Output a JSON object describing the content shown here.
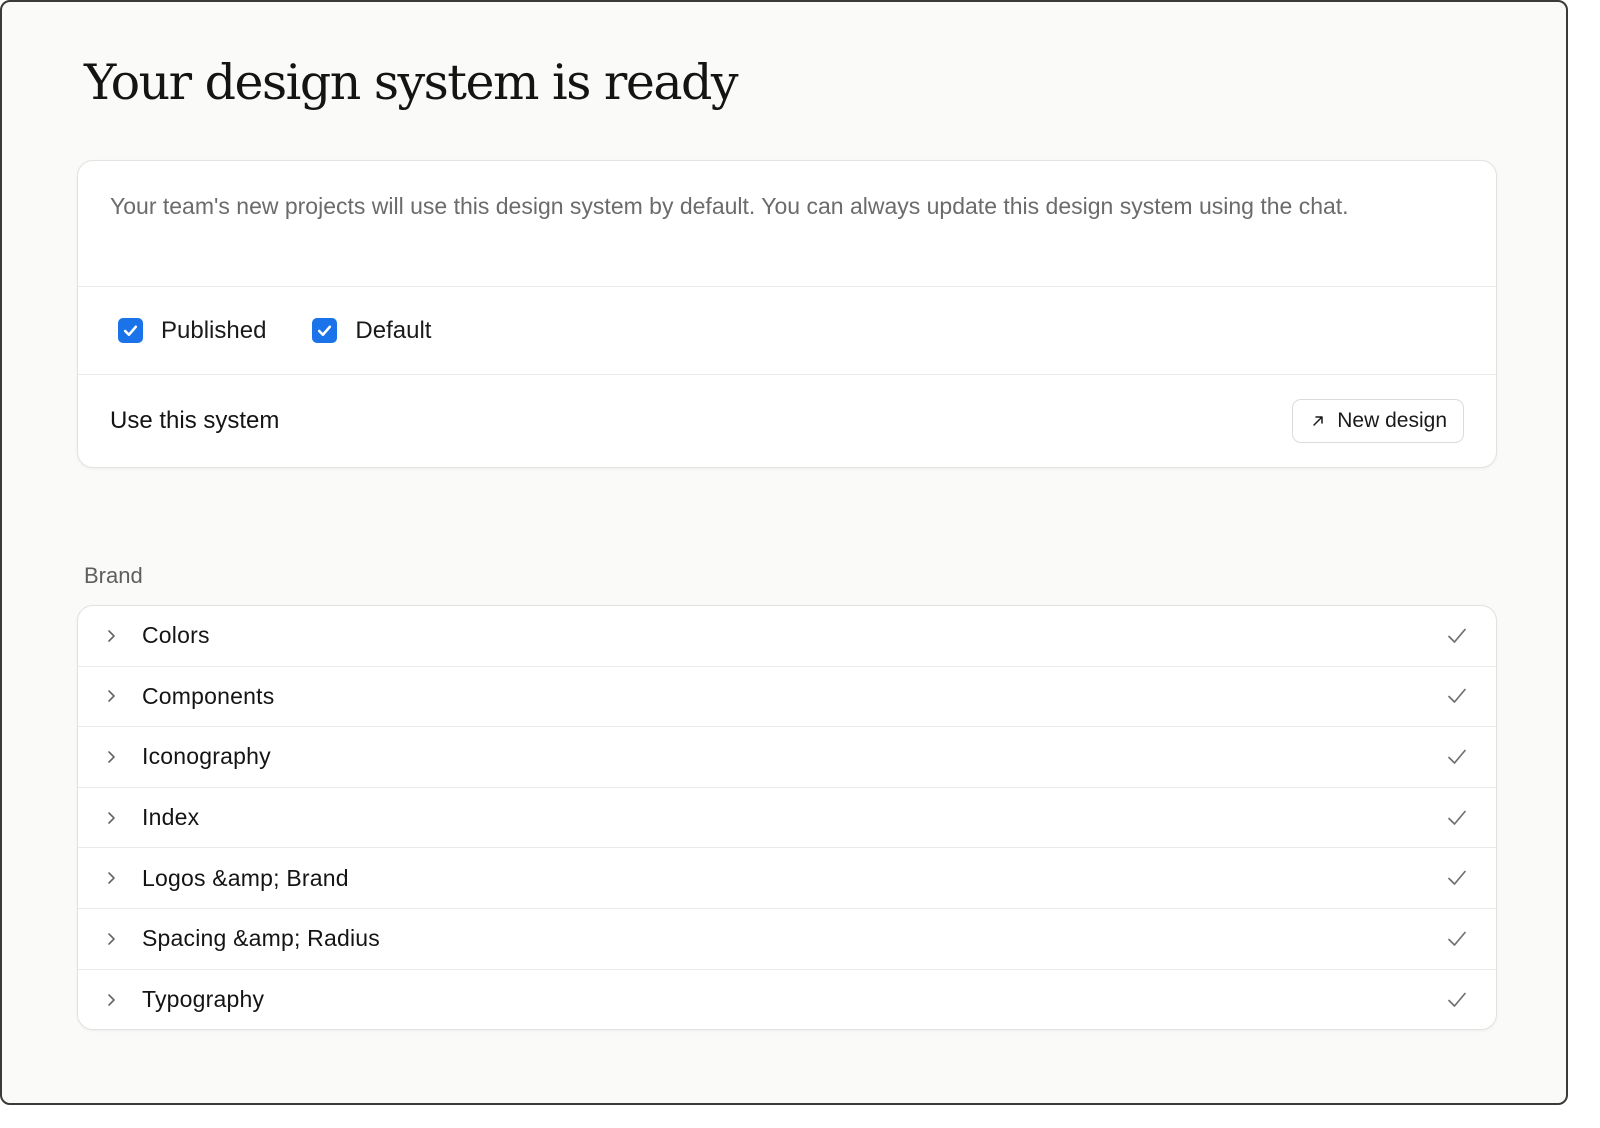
{
  "page": {
    "title": "Your design system is ready"
  },
  "info": {
    "description": "Your team's new projects will use this design system by default. You can always update this design system using the chat.",
    "checkboxes": [
      {
        "label": "Published",
        "checked": true
      },
      {
        "label": "Default",
        "checked": true
      }
    ],
    "use_label": "Use this system",
    "new_design_label": "New design",
    "new_design_icon": "arrow-up-right-icon"
  },
  "brand": {
    "section_label": "Brand",
    "items": [
      {
        "label": "Colors",
        "complete": true
      },
      {
        "label": "Components",
        "complete": true
      },
      {
        "label": "Iconography",
        "complete": true
      },
      {
        "label": "Index",
        "complete": true
      },
      {
        "label": "Logos &amp; Brand",
        "complete": true
      },
      {
        "label": "Spacing &amp; Radius",
        "complete": true
      },
      {
        "label": "Typography",
        "complete": true
      }
    ]
  },
  "colors": {
    "accent": "#1a73e8",
    "background": "#fafaf9",
    "card": "#ffffff"
  }
}
